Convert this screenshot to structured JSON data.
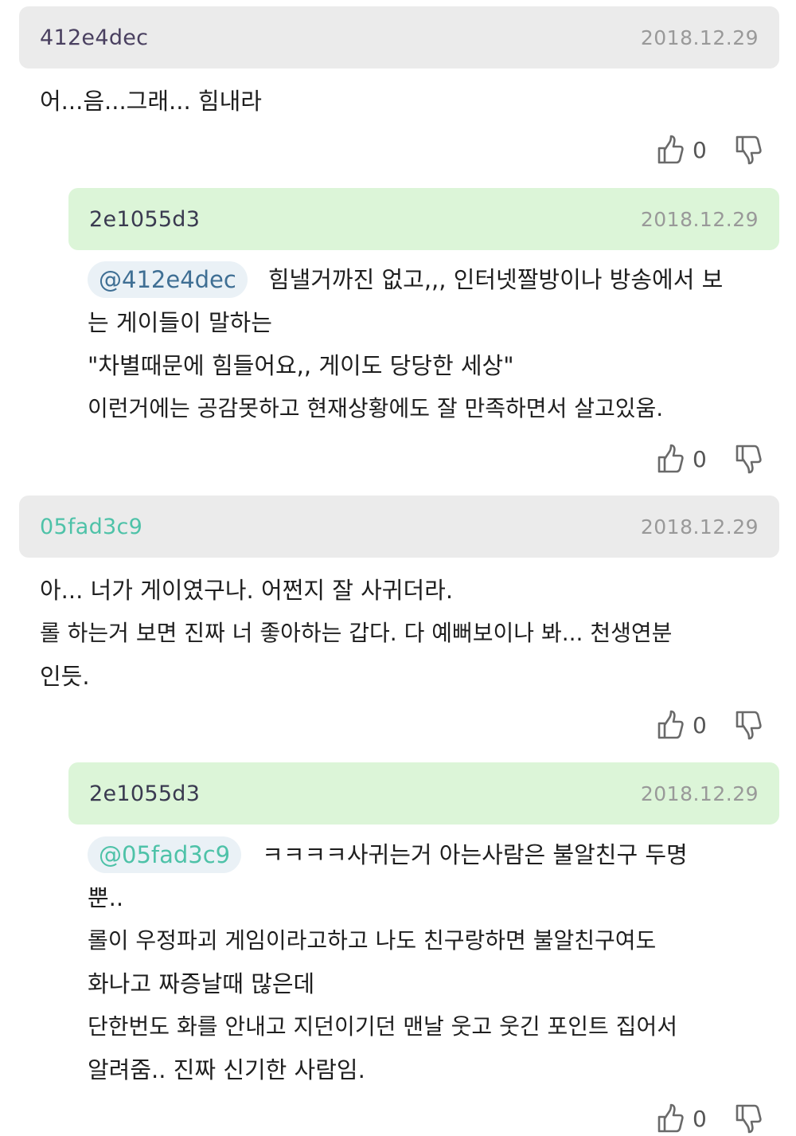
{
  "colors": {
    "header_gray": "#ebebeb",
    "header_green": "#dcf5d8",
    "mention_bg": "#eaf1f6"
  },
  "comments": [
    {
      "username": "412e4dec",
      "username_color": "#4a4060",
      "date": "2018.12.29",
      "header_style": "gray",
      "lines": [
        "어...음...그래... 힘내라"
      ],
      "likes": "0",
      "like_icon": "thumbs-up-icon",
      "dislike_icon": "thumbs-down-icon"
    },
    {
      "username": "2e1055d3",
      "username_color": "#3a3a50",
      "date": "2018.12.29",
      "header_style": "green",
      "mention": "@412e4dec",
      "mention_color": "#3f6f94",
      "lines": [
        "힘낼거까진 없고,,, 인터넷짤방이나 방송에서 보",
        "는 게이들이 말하는",
        "\"차별때문에 힘들어요,, 게이도 당당한 세상\"",
        "이런거에는 공감못하고 현재상황에도 잘 만족하면서 살고있움."
      ],
      "likes": "0",
      "like_icon": "thumbs-up-icon",
      "dislike_icon": "thumbs-down-icon"
    },
    {
      "username": "05fad3c9",
      "username_color": "#4ec2a8",
      "date": "2018.12.29",
      "header_style": "gray",
      "lines": [
        "아... 너가 게이였구나. 어쩐지 잘 사귀더라.",
        "롤 하는거 보면 진짜 너 좋아하는 갑다. 다 예뻐보이나 봐... 천생연분",
        "인듯."
      ],
      "likes": "0",
      "like_icon": "thumbs-up-icon",
      "dislike_icon": "thumbs-down-icon"
    },
    {
      "username": "2e1055d3",
      "username_color": "#3a3a50",
      "date": "2018.12.29",
      "header_style": "green",
      "mention": "@05fad3c9",
      "mention_color": "#4ec2a8",
      "lines": [
        "ㅋㅋㅋㅋ사귀는거 아는사람은 불알친구 두명",
        "뿐..",
        "롤이 우정파괴 게임이라고하고 나도 친구랑하면 불알친구여도",
        "화나고 짜증날때 많은데",
        "단한번도 화를 안내고 지던이기던 맨날 웃고 웃긴 포인트 집어서",
        "알려줌.. 진짜 신기한 사람임."
      ],
      "likes": "0",
      "like_icon": "thumbs-up-icon",
      "dislike_icon": "thumbs-down-icon"
    }
  ]
}
